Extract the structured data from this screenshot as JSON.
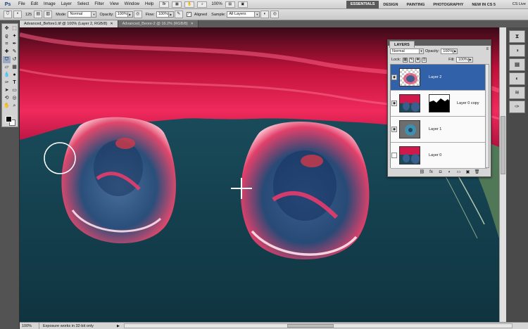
{
  "app": {
    "logo": "Ps",
    "menus": [
      "File",
      "Edit",
      "Image",
      "Layer",
      "Select",
      "Filter",
      "View",
      "Window",
      "Help"
    ],
    "zoom": "100%",
    "workspaces": [
      "ESSENTIALS",
      "DESIGN",
      "PAINTING",
      "PHOTOGRAPHY",
      "NEW IN CS 5"
    ],
    "active_workspace": "ESSENTIALS",
    "cs_live": "CS Live"
  },
  "options": {
    "brush_size": "125",
    "mode_label": "Mode:",
    "mode_value": "Normal",
    "opacity_label": "Opacity:",
    "opacity_value": "100%",
    "flow_label": "Flow:",
    "flow_value": "100%",
    "aligned_label": "Aligned",
    "sample_label": "Sample:",
    "sample_value": "All Layers"
  },
  "tabs": [
    {
      "label": "Advanced_Before1.tif @ 100% (Layer 2, RGB/8)",
      "active": true
    },
    {
      "label": "Advanced_Beore-2 @ 16.2% (RGB/8)",
      "active": false
    }
  ],
  "layers_panel": {
    "title": "LAYERS",
    "blend_mode": "Normal",
    "opacity_label": "Opacity:",
    "opacity_value": "100%",
    "lock_label": "Lock:",
    "fill_label": "Fill:",
    "fill_value": "100%",
    "layers": [
      {
        "name": "Layer 2",
        "selected": true,
        "visible": true
      },
      {
        "name": "Layer 0 copy",
        "selected": false,
        "visible": true
      },
      {
        "name": "Layer 1",
        "selected": false,
        "visible": true
      },
      {
        "name": "Layer 0",
        "selected": false,
        "visible": false
      }
    ]
  },
  "status": {
    "zoom": "100%",
    "info": "Exposure works in 32-bit only"
  },
  "colors": {
    "foreground": "#000000",
    "background": "#ffffff",
    "selection": "#3161a8"
  }
}
